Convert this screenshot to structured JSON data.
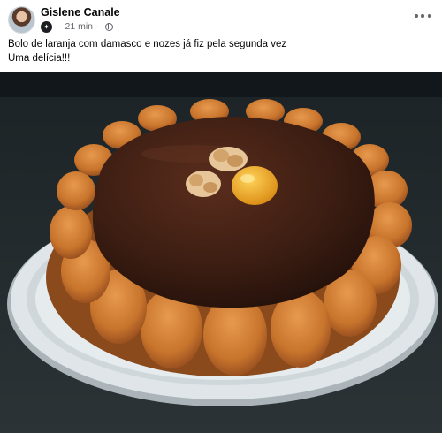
{
  "post": {
    "author": "Gislene Canale",
    "time": "21 min",
    "separator": "·",
    "text_line1": "Bolo de laranja com damasco e nozes já fiz pela segunda vez",
    "text_line2": "Uma delícia!!!"
  },
  "icons": {
    "more": "more-options-icon",
    "privacy": "globe-icon",
    "badge": "profile-badge-icon"
  },
  "colors": {
    "cake_crust": "#c8772f",
    "chocolate_glaze": "#3a1d12",
    "plate": "#dde3e6",
    "counter": "#20272a"
  }
}
